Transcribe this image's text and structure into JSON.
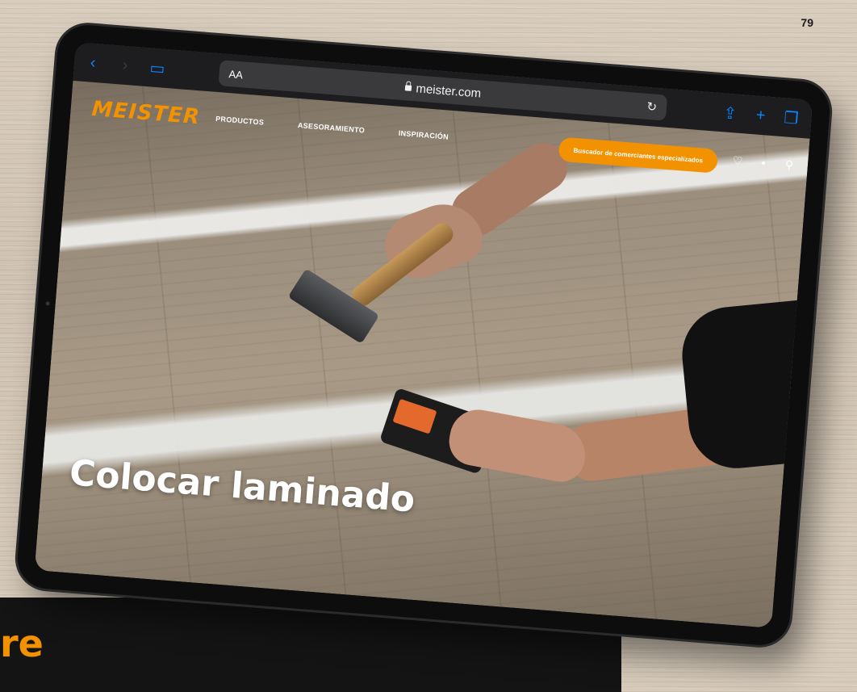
{
  "page": {
    "number": "79",
    "bottom_fragment": "re"
  },
  "browser": {
    "url": "meister.com",
    "aa_label": "AA",
    "icons": [
      "chevron-left-icon",
      "chevron-right-icon",
      "book-icon",
      "lock-icon",
      "reload-icon",
      "share-icon",
      "plus-icon",
      "tabs-icon"
    ],
    "accent_color": "#0a84ff"
  },
  "site": {
    "logo": "MEISTER",
    "nav": [
      "PRODUCTOS",
      "ASESORAMIENTO",
      "INSPIRACIÓN"
    ],
    "dealer_button": "Buscador de comerciantes especializados",
    "icons": [
      "heart-icon",
      "bookmark-icon",
      "search-icon"
    ],
    "brand_color": "#f39200"
  },
  "hero": {
    "title": "Colocar laminado"
  }
}
